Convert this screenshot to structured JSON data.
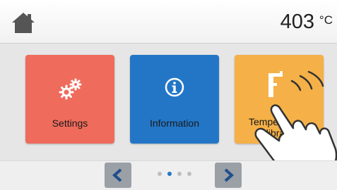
{
  "header": {
    "home_icon": "home-icon",
    "temperature": "403",
    "unit": "°C"
  },
  "tiles": [
    {
      "label": "Settings",
      "icon": "gear-icon",
      "color": "#ef6b5c"
    },
    {
      "label": "Information",
      "icon": "info-icon",
      "color": "#2376c6"
    },
    {
      "label": "Temperature calibration",
      "label_visible": "Temper calibrat",
      "icon": "thermometer-icon",
      "color": "#f5b047"
    }
  ],
  "pager": {
    "prev_icon": "chevron-left-icon",
    "next_icon": "chevron-right-icon",
    "page_count": 4,
    "active_page": 2
  }
}
